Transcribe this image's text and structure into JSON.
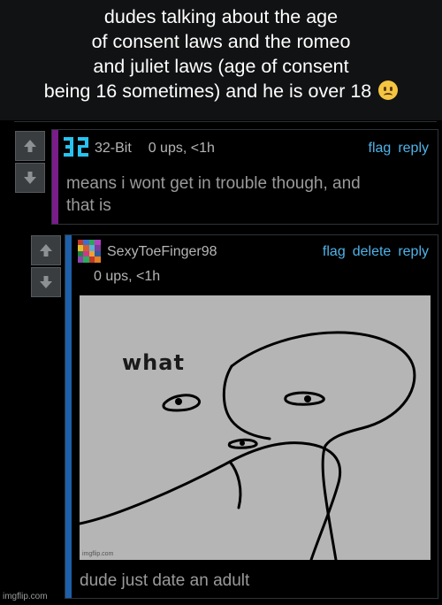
{
  "caption": {
    "lines": [
      "dudes talking about the age",
      "of consent laws and the romeo",
      "and juliet laws (age of consent",
      "being 16 sometimes) and he is over 18"
    ],
    "emoji": "worried-face"
  },
  "comments": [
    {
      "username": "32-Bit",
      "meta": "0 ups, <1h",
      "actions": [
        "flag",
        "reply"
      ],
      "text": "means i wont get in trouble though, and that is",
      "text_lines": [
        "means i wont get in trouble though, and",
        "that is"
      ],
      "stripe_color": "#7a1c8a"
    },
    {
      "username": "SexyToeFinger98",
      "meta": "0 ups, <1h",
      "actions": [
        "flag",
        "delete",
        "reply"
      ],
      "image_text": "what",
      "image_watermark": "imgflip.com",
      "text": "dude just date an adult",
      "stripe_color": "#1d5fa8"
    }
  ],
  "footer": {
    "watermark": "imgflip.com"
  },
  "colors": {
    "link": "#4fb3e8",
    "background": "#000000",
    "caption_bg": "#111213"
  }
}
